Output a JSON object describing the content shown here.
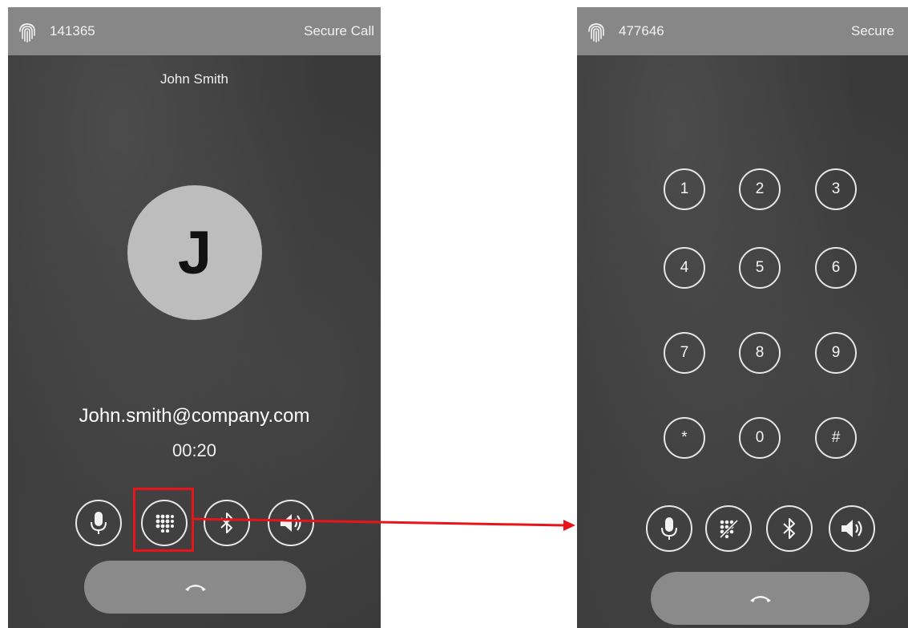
{
  "left_screen": {
    "status_bar": {
      "call_id": "141365",
      "secure_label": "Secure Call",
      "icon": "fingerprint-icon"
    },
    "caller_name": "John Smith",
    "avatar_letter": "J",
    "caller_email": "John.smith@company.com",
    "call_timer": "00:20",
    "controls": [
      "microphone-icon",
      "dialpad-icon",
      "bluetooth-icon",
      "speaker-icon"
    ],
    "end_call_icon": "phone-hangup-icon"
  },
  "right_screen": {
    "status_bar": {
      "call_id": "477646",
      "secure_label": "Secure",
      "icon": "fingerprint-icon"
    },
    "keypad": [
      "1",
      "2",
      "3",
      "4",
      "5",
      "6",
      "7",
      "8",
      "9",
      "*",
      "0",
      "#"
    ],
    "controls": [
      "microphone-icon",
      "dialpad-off-icon",
      "bluetooth-icon",
      "speaker-icon"
    ],
    "end_call_icon": "phone-hangup-icon"
  },
  "colors": {
    "page_background": "#ffffff",
    "phone_background": "#3a3a3a",
    "status_bar": "#878787",
    "avatar": "#bdbdbd",
    "end_call_button": "#8a8a8a",
    "annotation": "#e8141b"
  }
}
